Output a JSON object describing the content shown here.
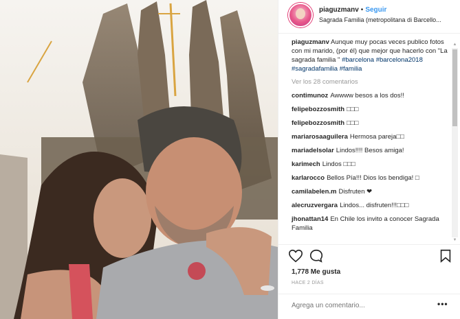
{
  "photo": {
    "description_icon": "photo-icon"
  },
  "header": {
    "username": "piaguzmanv",
    "separator": "•",
    "follow_label": "Seguir",
    "location": "Sagrada Familia (metropolitana di Barcello..."
  },
  "caption": {
    "username": "piaguzmanv",
    "text": "Aunque muy pocas veces publico fotos con mi marido, (por él) que mejor que hacerlo con \"La sagrada familia \"",
    "hashtags": [
      "#barcelona",
      "#barcelona2018",
      "#sagradafamilia",
      "#familia"
    ]
  },
  "view_all": "Ver los 28 comentarios",
  "comments": [
    {
      "user": "contimunoz",
      "text": "Awwww besos a los dos!!"
    },
    {
      "user": "felipebozzosmith",
      "text": "□□□"
    },
    {
      "user": "felipebozzosmith",
      "text": "□□□"
    },
    {
      "user": "mariarosaaguilera",
      "text": "Hermosa pareja□□"
    },
    {
      "user": "mariadelsolar",
      "text": "Lindos!!!! Besos amiga!"
    },
    {
      "user": "karimech",
      "text": "Lindos □□□"
    },
    {
      "user": "karlarocco",
      "text": "Bellos Pía!!! Dios los bendiga! □"
    },
    {
      "user": "camilabelen.m",
      "text": "Disfruten ❤"
    },
    {
      "user": "alecruzvergara",
      "text": "Lindos... disfruten!!!□□□"
    },
    {
      "user": "jhonattan14",
      "text": "En Chile los invito a conocer Sagrada Familia"
    }
  ],
  "actions": {
    "like_icon": "heart-icon",
    "comment_icon": "speech-bubble-icon",
    "save_icon": "bookmark-icon"
  },
  "likes": "1,778 Me gusta",
  "time_ago": "HACE 2 DÍAS",
  "add_comment_placeholder": "Agrega un comentario...",
  "more_label": "•••",
  "scrollbar": {
    "up": "▲",
    "down": "▼"
  },
  "colors": {
    "link_blue": "#3897f0",
    "hashtag": "#003569",
    "muted": "#999999",
    "text": "#262626"
  }
}
